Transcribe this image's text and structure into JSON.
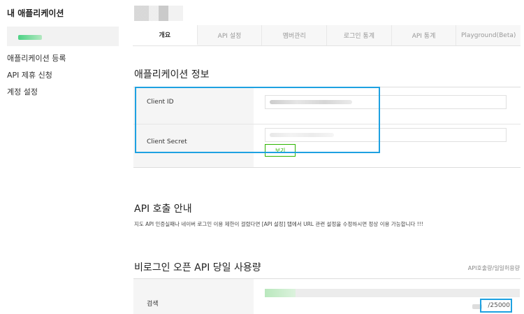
{
  "sidebar": {
    "title": "내 애플리케이션",
    "links": [
      "애플리케이션 등록",
      "API 제휴 신청",
      "계정 설정"
    ]
  },
  "tabs": [
    {
      "label": "개요",
      "active": true
    },
    {
      "label": "API 설정",
      "active": false
    },
    {
      "label": "멤버관리",
      "active": false
    },
    {
      "label": "로그인 통계",
      "active": false
    },
    {
      "label": "API 통계",
      "active": false
    },
    {
      "label": "Playground(Beta)",
      "active": false
    }
  ],
  "app_info": {
    "title": "애플리케이션 정보",
    "client_id_label": "Client ID",
    "client_secret_label": "Client Secret",
    "show_button": "보기"
  },
  "api_guide": {
    "title": "API 호출 안내",
    "notice": "지도 API 인증실패나 네이버 로그인 이용 제한이 걸렸다면 [API 설정] 탭에서 URL 관련 설정을 수정하시면 정상 이용 가능합니다 !!!"
  },
  "usage": {
    "title": "비로그인 오픈 API 당일 사용량",
    "caption": "API호출량/일일허용량",
    "label": "검색",
    "count": "/25000",
    "fill_fraction": 0.12
  },
  "colors": {
    "highlight": "#1ea1e1",
    "accent_green": "#2db400"
  }
}
